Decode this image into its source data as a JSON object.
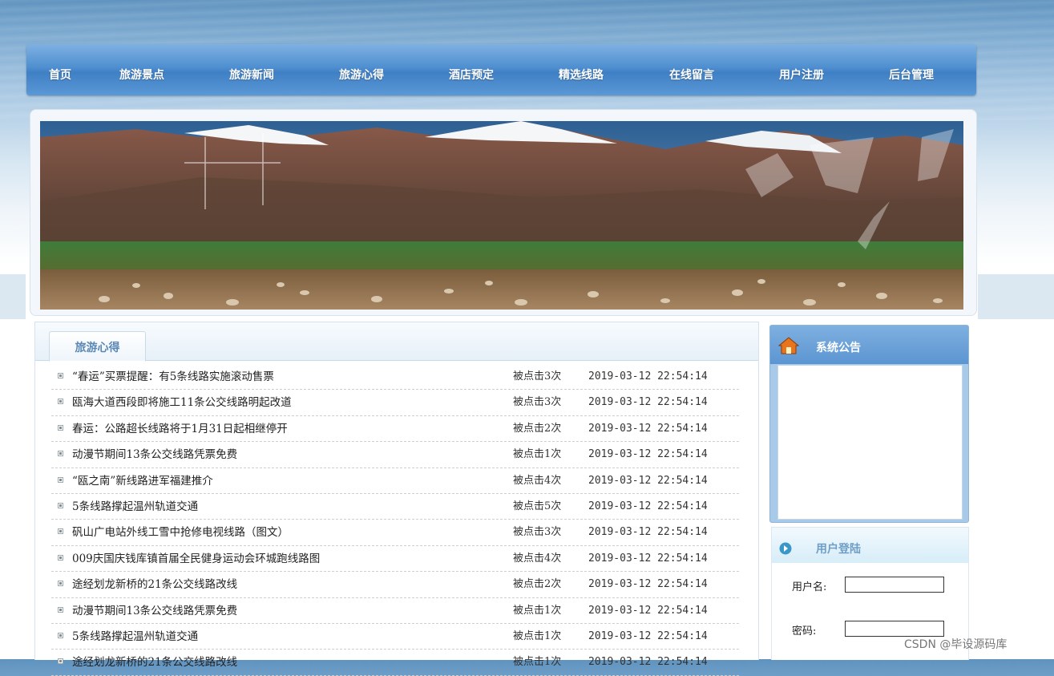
{
  "nav": {
    "items": [
      "首页",
      "旅游景点",
      "旅游新闻",
      "旅游心得",
      "酒店预定",
      "精选线路",
      "在线留言",
      "用户注册",
      "后台管理"
    ]
  },
  "main": {
    "tab_label": "旅游心得",
    "rows": [
      {
        "title": "“春运”买票提醒：有5条线路实施滚动售票",
        "clicks": "被点击3次",
        "date": "2019-03-12 22:54:14"
      },
      {
        "title": "瓯海大道西段即将施工11条公交线路明起改道",
        "clicks": "被点击3次",
        "date": "2019-03-12 22:54:14"
      },
      {
        "title": "春运：公路超长线路将于1月31日起相继停开",
        "clicks": "被点击2次",
        "date": "2019-03-12 22:54:14"
      },
      {
        "title": "动漫节期间13条公交线路凭票免费",
        "clicks": "被点击1次",
        "date": "2019-03-12 22:54:14"
      },
      {
        "title": "“瓯之南”新线路进军福建推介",
        "clicks": "被点击4次",
        "date": "2019-03-12 22:54:14"
      },
      {
        "title": "5条线路撑起温州轨道交通",
        "clicks": "被点击5次",
        "date": "2019-03-12 22:54:14"
      },
      {
        "title": "矾山广电站外线工雪中抢修电视线路（图文）",
        "clicks": "被点击3次",
        "date": "2019-03-12 22:54:14"
      },
      {
        "title": "009庆国庆钱库镇首届全民健身运动会环城跑线路图",
        "clicks": "被点击4次",
        "date": "2019-03-12 22:54:14"
      },
      {
        "title": "途经划龙新桥的21条公交线路改线",
        "clicks": "被点击2次",
        "date": "2019-03-12 22:54:14"
      },
      {
        "title": "动漫节期间13条公交线路凭票免费",
        "clicks": "被点击1次",
        "date": "2019-03-12 22:54:14"
      },
      {
        "title": "5条线路撑起温州轨道交通",
        "clicks": "被点击1次",
        "date": "2019-03-12 22:54:14"
      },
      {
        "title": "途经划龙新桥的21条公交线路改线",
        "clicks": "被点击1次",
        "date": "2019-03-12 22:54:14"
      }
    ]
  },
  "sidebar": {
    "notice_title": "系统公告",
    "login_title": "用户登陆",
    "username_label": "用户名:",
    "password_label": "密码:",
    "username_value": "",
    "password_value": ""
  },
  "watermark": "CSDN @毕设源码库",
  "icons": {
    "home": "home-icon",
    "arrow": "circle-arrow-icon",
    "bullet": "square-bullet-icon"
  },
  "colors": {
    "nav_bg": "#4f8fd0",
    "tab_text": "#5c88b5",
    "notice_head": "#5b95d1",
    "login_title": "#6e9ec6"
  }
}
